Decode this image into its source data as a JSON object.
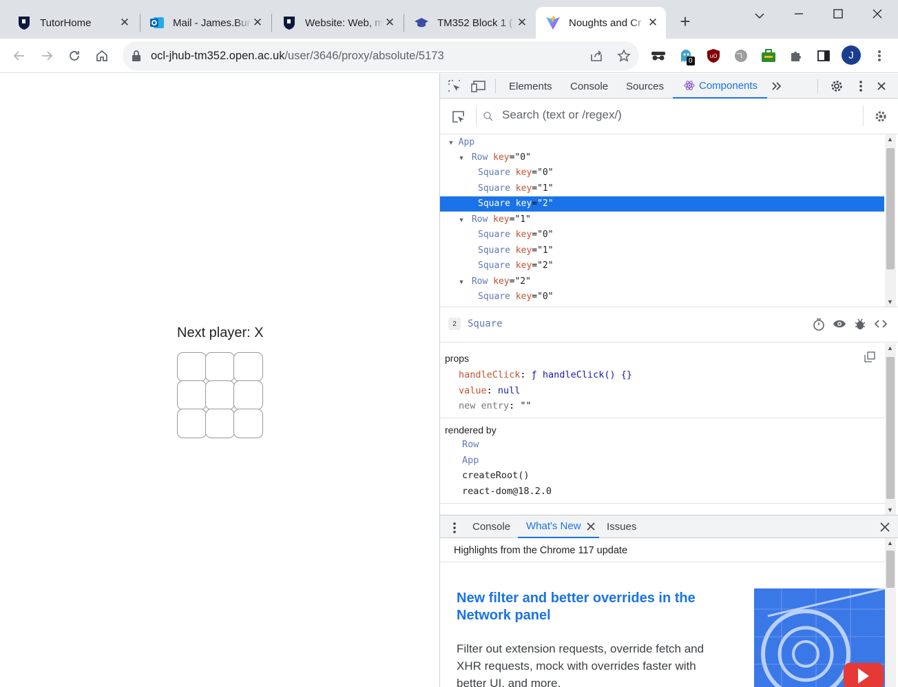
{
  "browser": {
    "tabs": [
      {
        "title": "TutorHome",
        "icon": "ou-shield-icon"
      },
      {
        "title": "Mail - James.Bur",
        "icon": "outlook-icon"
      },
      {
        "title": "Website: Web, m",
        "icon": "ou-shield-icon"
      },
      {
        "title": "TM352 Block 1 (",
        "icon": "graduation-cap-icon"
      },
      {
        "title": "Noughts and Cr",
        "icon": "vite-icon",
        "active": true
      }
    ],
    "new_tab": "+",
    "url_host": "ocl-jhub-tm352.open.ac.uk",
    "url_path": "/user/3646/proxy/absolute/5173",
    "profile_initial": "J",
    "ghost_badge": "0"
  },
  "page": {
    "status": "Next player: X",
    "board": [
      null,
      null,
      null,
      null,
      null,
      null,
      null,
      null,
      null
    ]
  },
  "devtools": {
    "tabs": [
      "Elements",
      "Console",
      "Sources",
      "Components"
    ],
    "selected_tab": "Components",
    "search_placeholder": "Search (text or /regex/)",
    "tree": [
      {
        "name": "App",
        "key": null,
        "depth": 0,
        "expanded": true
      },
      {
        "name": "Row",
        "key": "\"0\"",
        "depth": 1,
        "expanded": true
      },
      {
        "name": "Square",
        "key": "\"0\"",
        "depth": 2
      },
      {
        "name": "Square",
        "key": "\"1\"",
        "depth": 2
      },
      {
        "name": "Square",
        "key": "\"2\"",
        "depth": 2,
        "selected": true
      },
      {
        "name": "Row",
        "key": "\"1\"",
        "depth": 1,
        "expanded": true
      },
      {
        "name": "Square",
        "key": "\"0\"",
        "depth": 2
      },
      {
        "name": "Square",
        "key": "\"1\"",
        "depth": 2
      },
      {
        "name": "Square",
        "key": "\"2\"",
        "depth": 2
      },
      {
        "name": "Row",
        "key": "\"2\"",
        "depth": 1,
        "expanded": true
      },
      {
        "name": "Square",
        "key": "\"0\"",
        "depth": 2
      }
    ],
    "selected": {
      "badge": "2",
      "name": "Square"
    },
    "props_title": "props",
    "props": [
      {
        "key": "handleClick",
        "value": "ƒ handleClick() {}"
      },
      {
        "key": "value",
        "value": "null"
      },
      {
        "key": "new entry",
        "value": "\"\""
      }
    ],
    "rendered_by_title": "rendered by",
    "rendered_by": [
      {
        "text": "Row",
        "component": true
      },
      {
        "text": "App",
        "component": true
      },
      {
        "text": "createRoot()",
        "component": false
      },
      {
        "text": "react-dom@18.2.0",
        "component": false
      }
    ],
    "drawer": {
      "tabs": [
        "Console",
        "What's New",
        "Issues"
      ],
      "selected_tab": "What's New",
      "highlights": "Highlights from the Chrome 117 update",
      "article_title": "New filter and better overrides in the Network panel",
      "article_desc": "Filter out extension requests, override fetch and XHR requests, mock with overrides faster with better UI, and more."
    }
  },
  "colors": {
    "accent": "#1a73e8",
    "component": "#5f78b8",
    "key": "#c5512f"
  }
}
